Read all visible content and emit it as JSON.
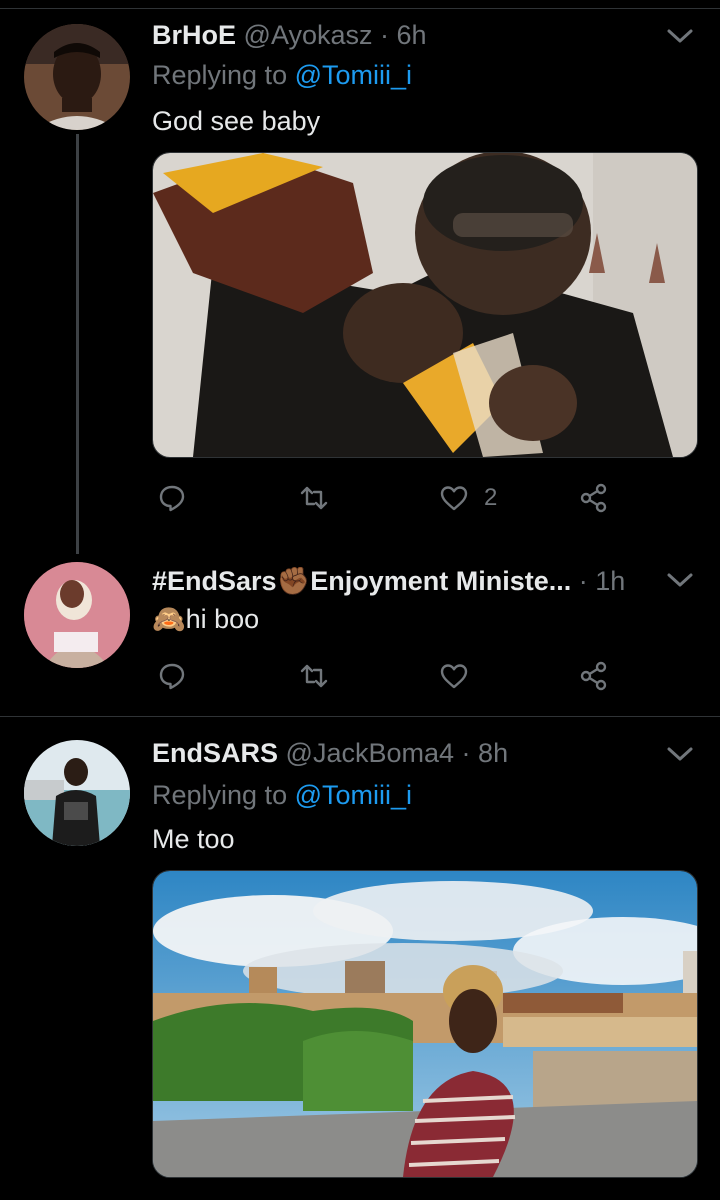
{
  "tweets": [
    {
      "name": "BrHoE",
      "handle": "@Ayokasz",
      "dot": "·",
      "time": "6h",
      "replying_prefix": "Replying to ",
      "replying_to": "@Tomiii_i",
      "text": "God see baby",
      "actions": {
        "reply_count": "",
        "retweet_count": "",
        "like_count": "2"
      }
    },
    {
      "name_prefix": "#EndSars",
      "name_emoji": "✊🏾",
      "name_suffix": "Enjoyment Ministe...",
      "dot": "·",
      "time": "1h",
      "text_emoji": "🙈",
      "text": "hi boo",
      "actions": {
        "reply_count": "",
        "retweet_count": "",
        "like_count": ""
      }
    },
    {
      "name": "EndSARS",
      "handle": "@JackBoma4",
      "dot": "·",
      "time": "8h",
      "replying_prefix": "Replying to ",
      "replying_to": "@Tomiii_i",
      "text": "Me too"
    }
  ],
  "colors": {
    "background": "#000000",
    "text": "#e7e9ea",
    "muted": "#71767b",
    "link": "#1d9bf0",
    "divider": "#2f3336"
  },
  "icons": [
    "reply-icon",
    "retweet-icon",
    "like-icon",
    "share-icon",
    "chevron-down-icon"
  ]
}
